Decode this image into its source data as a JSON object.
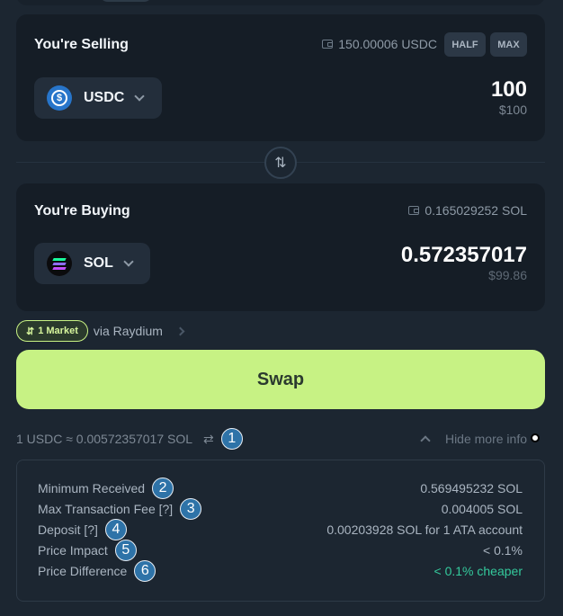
{
  "selling": {
    "title": "You're Selling",
    "balance": "150.00006 USDC",
    "half_label": "HALF",
    "max_label": "MAX",
    "token": "USDC",
    "token_icon": "usdc-logo",
    "amount": "100",
    "amount_usd": "$100"
  },
  "buying": {
    "title": "You're Buying",
    "balance": "0.165029252 SOL",
    "token": "SOL",
    "token_icon": "sol-logo",
    "amount": "0.572357017",
    "amount_usd": "$99.86"
  },
  "route": {
    "badge": "1 Market",
    "via": "via Raydium"
  },
  "swap_label": "Swap",
  "rate": {
    "text": "1 USDC ≈ 0.00572357017 SOL",
    "toggle_label": "Hide more info"
  },
  "annotations": [
    "1",
    "2",
    "3",
    "4",
    "5",
    "6"
  ],
  "info": [
    {
      "label": "Minimum Received",
      "value": "0.569495232 SOL"
    },
    {
      "label": "Max Transaction Fee [?]",
      "value": "0.004005 SOL"
    },
    {
      "label": "Deposit [?]",
      "value": "0.00203928 SOL for 1 ATA account"
    },
    {
      "label": "Price Impact",
      "value": "< 0.1%"
    },
    {
      "label": "Price Difference",
      "value": "< 0.1% cheaper"
    }
  ],
  "colors": {
    "background": "#1c2631",
    "card": "#151d26",
    "accent": "#c7f284",
    "positive": "#34c99c",
    "annotation": "#2e73a8"
  }
}
